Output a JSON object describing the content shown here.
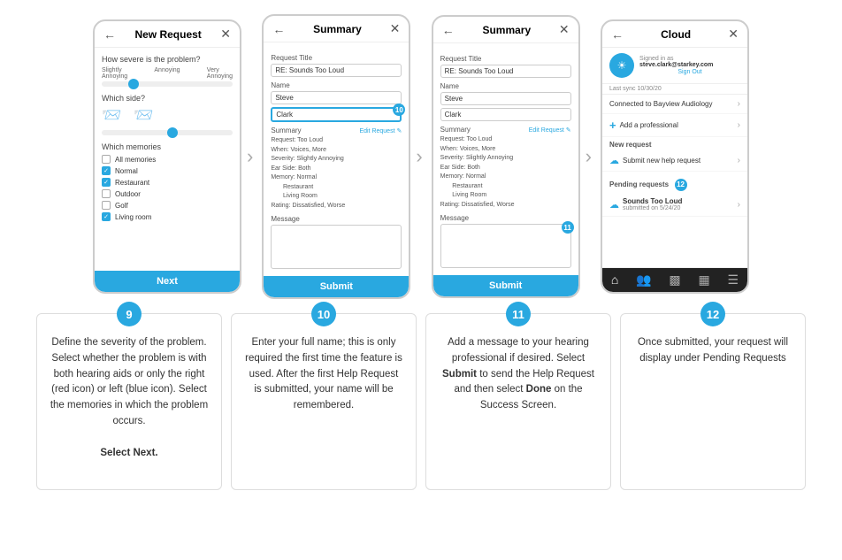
{
  "phones": [
    {
      "id": "new-request",
      "header_title": "New Request",
      "step": null,
      "footer_label": "Next",
      "content": {
        "severity_label": "How severe is the problem?",
        "severity_ticks": [
          "Slightly Annoying",
          "Annoying",
          "Very Annoying"
        ],
        "side_label": "Which side?",
        "memories_label": "Which memories",
        "memories": [
          {
            "label": "All memories",
            "checked": false
          },
          {
            "label": "Normal",
            "checked": true
          },
          {
            "label": "Restaurant",
            "checked": true
          },
          {
            "label": "Outdoor",
            "checked": false
          },
          {
            "label": "Golf",
            "checked": false
          },
          {
            "label": "Living room",
            "checked": true
          }
        ]
      }
    },
    {
      "id": "summary-1",
      "header_title": "Summary",
      "step": null,
      "footer_label": "Submit",
      "content": {
        "request_title_label": "Request Title",
        "request_title_value": "RE: Sounds Too Loud",
        "name_label": "Name",
        "name_value_1": "Steve",
        "name_value_2": "Clark",
        "name_badge": "10",
        "summary_label": "Summary",
        "edit_label": "Edit Request",
        "summary_detail": "Request: Too Loud\nWhen: Voices, More\nSeverity: Slightly Annoying\nEar Side: Both\nMemory: Normal\n        Restaurant\n        Living Room\nRating: Dissatisfied, Worse",
        "message_label": "Message"
      }
    },
    {
      "id": "summary-2",
      "header_title": "Summary",
      "step": null,
      "footer_label": "Submit",
      "content": {
        "request_title_label": "Request Title",
        "request_title_value": "RE: Sounds Too Loud",
        "name_label": "Name",
        "name_value_1": "Steve",
        "name_value_2": "Clark",
        "summary_label": "Summary",
        "edit_label": "Edit Request",
        "summary_detail": "Request: Too Loud\nWhen: Voices, More\nSeverity: Slightly Annoying\nEar Side: Both\nMemory: Normal\n        Restaurant\n        Living Room\nRating: Dissatisfied, Worse",
        "message_label": "Message",
        "message_badge": "11"
      }
    },
    {
      "id": "cloud",
      "header_title": "Cloud",
      "step": null,
      "content": {
        "signed_in_label": "Signed in as",
        "email": "steve.clark@starkey.com",
        "signout_label": "Sign Out",
        "last_sync": "Last sync 10/30/20",
        "connected_label": "Connected to Bayview Audiology",
        "add_professional_label": "Add a professional",
        "new_request_header": "New request",
        "submit_label": "Submit new help request",
        "pending_label": "Pending requests",
        "pending_badge": "12",
        "pending_item": "Sounds Too Loud",
        "pending_date": "submitted on 5/24/20"
      }
    }
  ],
  "steps": [
    {
      "number": "9",
      "text": "Define the severity of the problem. Select whether the problem is with both hearing aids or only the right (red icon) or left (blue icon). Select the memories in which the problem occurs.",
      "bold_suffix": "Select Next."
    },
    {
      "number": "10",
      "text": "Enter your full name; this is only required the first time the feature is used. After the first Help Request is submitted, your name will be remembered.",
      "bold_suffix": null
    },
    {
      "number": "11",
      "text": "Add a message to your hearing professional if desired. Select",
      "bold_mid": "Submit",
      "text2": " to send the Help Request and then select ",
      "bold_suffix2": "Done",
      "text3": " on the Success Screen.",
      "bold_suffix": null
    },
    {
      "number": "12",
      "text": "Once submitted, your request will display under Pending Requests",
      "bold_suffix": null
    }
  ]
}
